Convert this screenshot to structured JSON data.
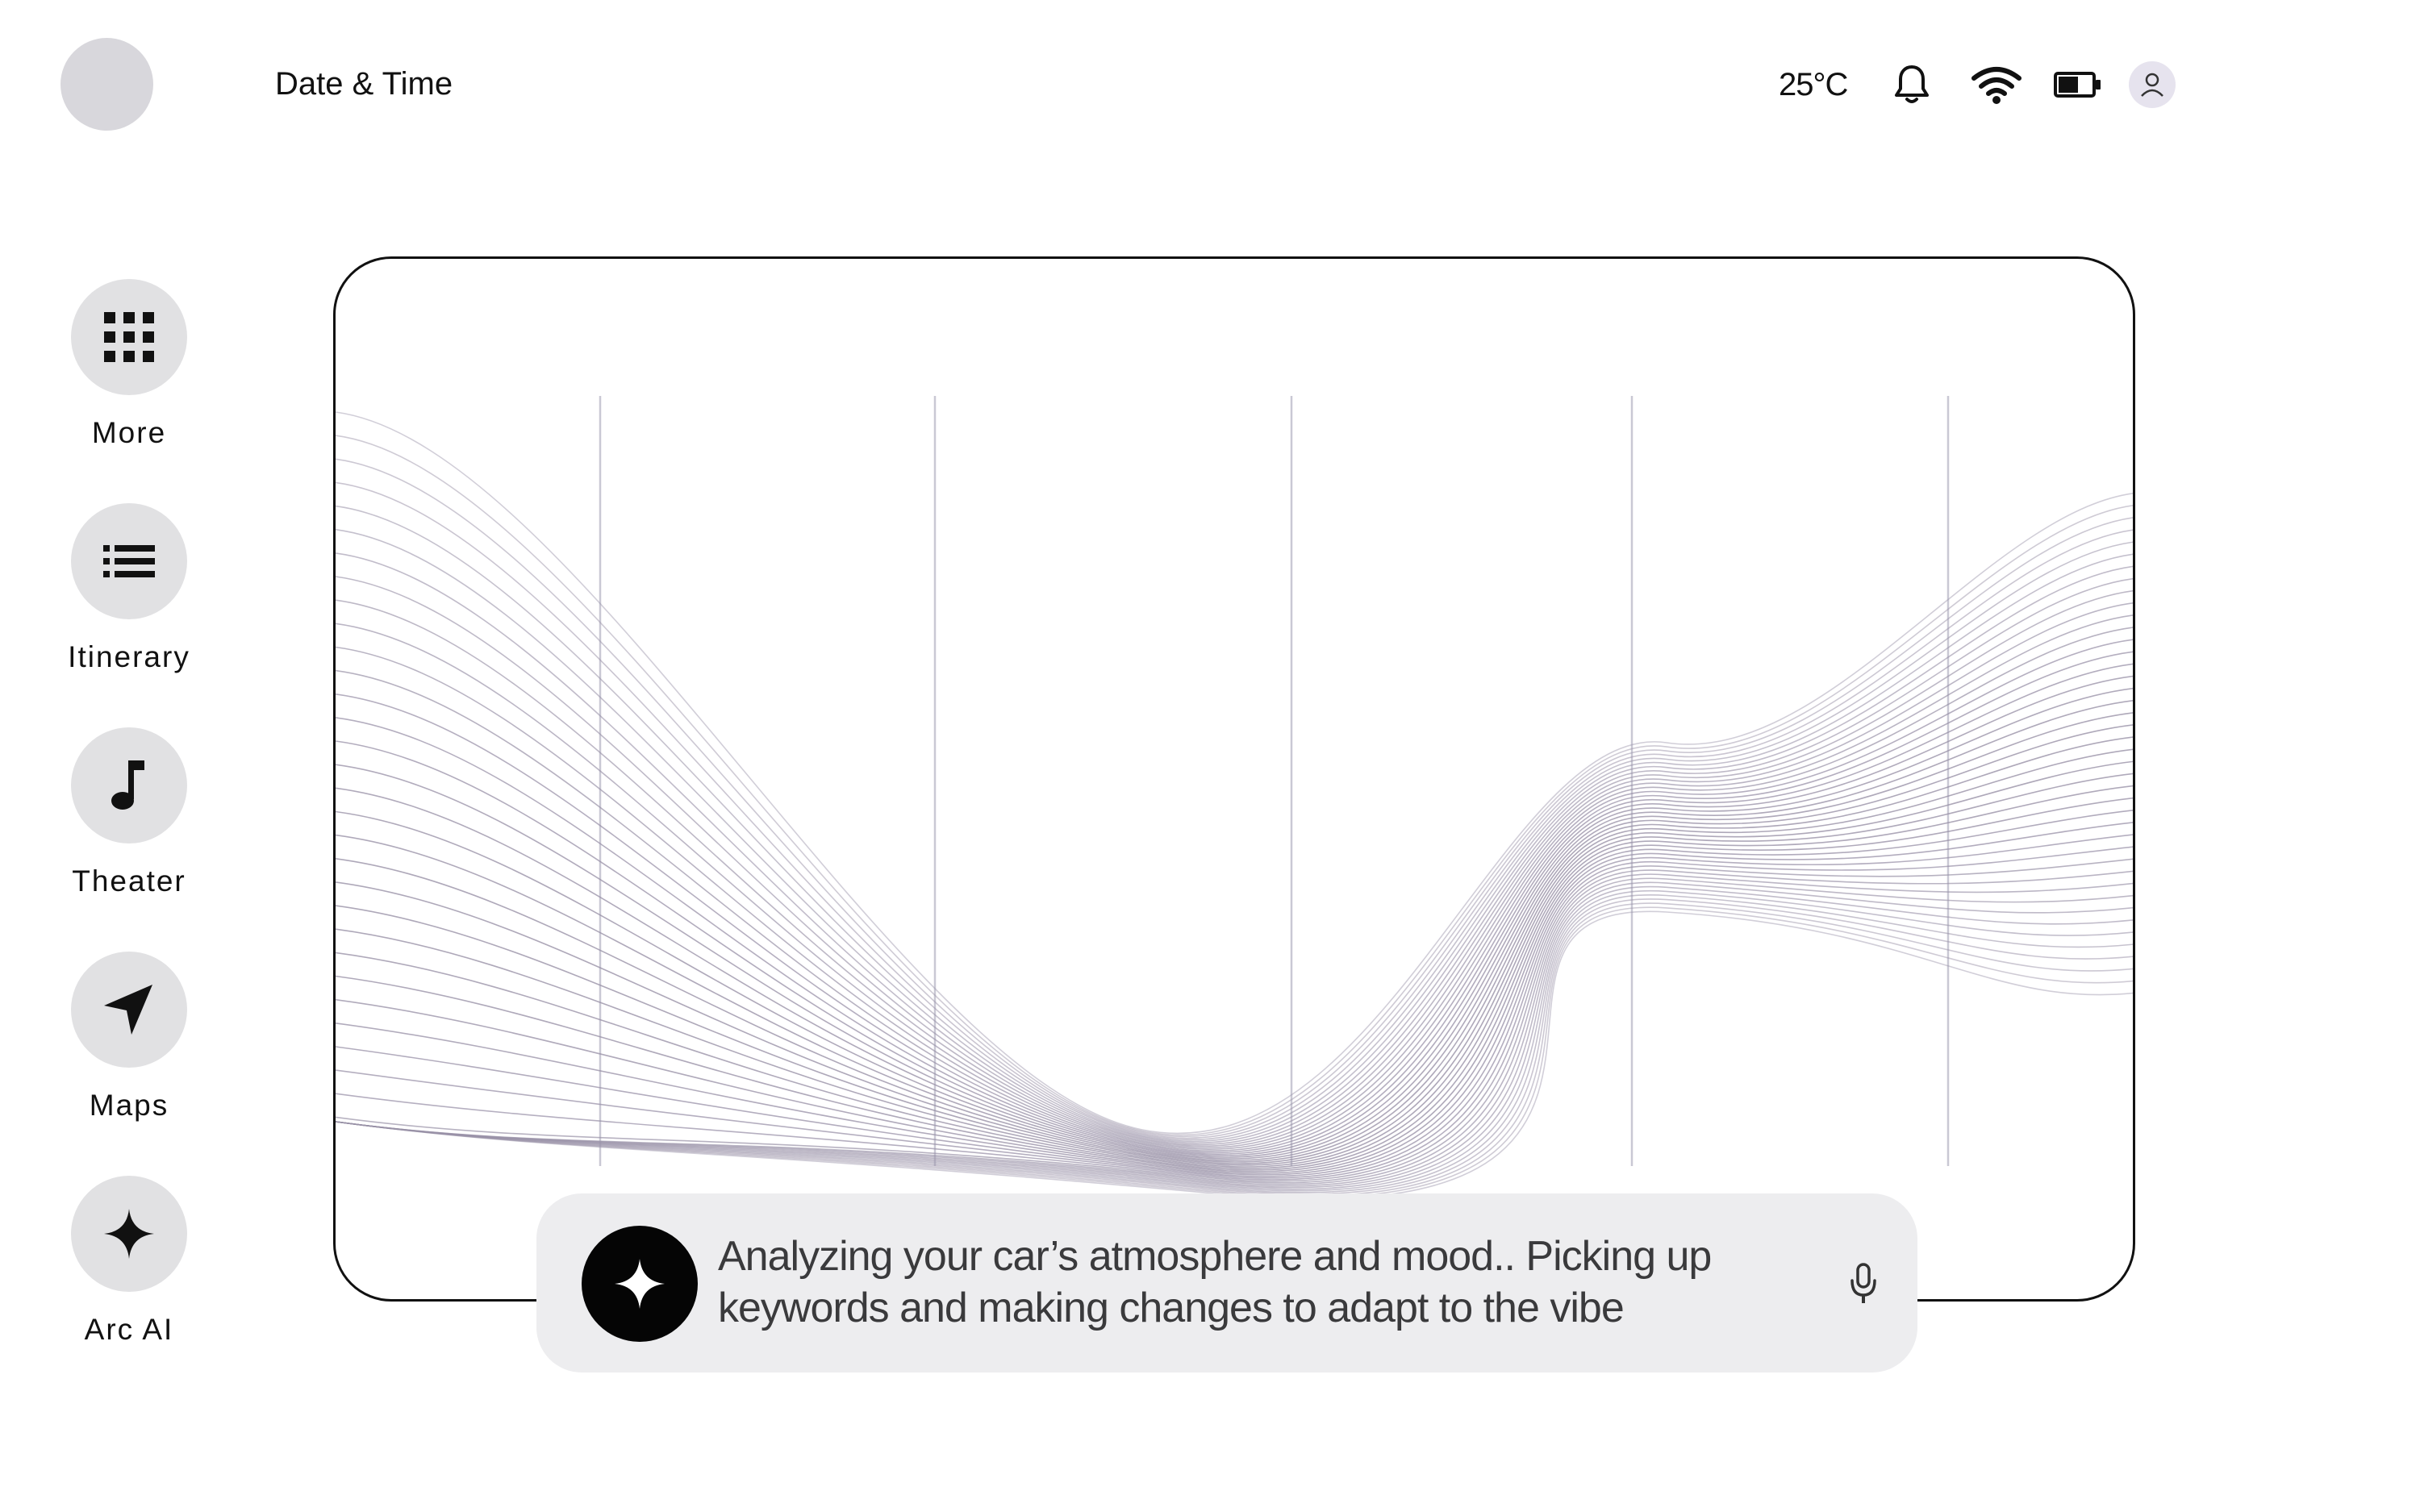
{
  "header": {
    "datetime_label": "Date & Time",
    "temperature": "25°C",
    "icons": [
      "bell-icon",
      "wifi-icon",
      "battery-icon",
      "profile-icon"
    ]
  },
  "sidebar": {
    "items": [
      {
        "label": "More",
        "icon": "grid-icon"
      },
      {
        "label": "Itinerary",
        "icon": "list-icon"
      },
      {
        "label": "Theater",
        "icon": "music-note-icon"
      },
      {
        "label": "Maps",
        "icon": "navigation-arrow-icon"
      },
      {
        "label": "Arc AI",
        "icon": "sparkle-icon"
      }
    ]
  },
  "prompt": {
    "text": "Analyzing your car’s atmosphere and mood.. Picking up keywords and making changes to adapt to the vibe",
    "icon": "sparkle-icon",
    "mic_icon": "microphone-icon"
  },
  "colors": {
    "nav_button_bg": "#e1e1e3",
    "prompt_bg": "#ededef",
    "wave_line": "#9a92a8",
    "grid_line": "#c9c8d4"
  }
}
